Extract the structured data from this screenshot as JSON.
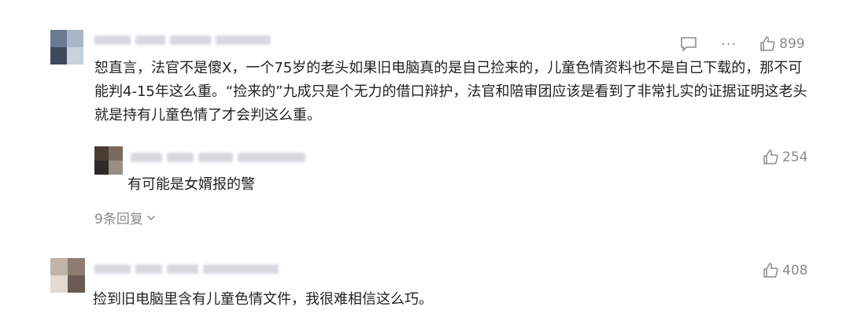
{
  "comments": [
    {
      "id": 1,
      "text": "恕直言，法官不是傻X，一个75岁的老头如果旧电脑真的是自己捡来的，儿童色情资料也不是自己下载的，那不可能判4-15年这么重。“捡来的”九成只是个无力的借口辩护，法官和陪审团应该是看到了非常扎实的证据证明这老头就是持有儿童色情了才会判这么重。",
      "likes": "899",
      "icons": [
        "comment-icon",
        "more-icon",
        "like-icon"
      ],
      "avatar_colors": [
        "#6b7a91",
        "#aab6c8",
        "#3e4a5c",
        "#c9d1dc"
      ]
    },
    {
      "id": 2,
      "text": "有可能是女婿报的警",
      "likes": "254",
      "icons": [
        "like-icon"
      ],
      "avatar_colors": [
        "#4a3b33",
        "#7a6a5e",
        "#2f2a27",
        "#9a8f86"
      ]
    },
    {
      "id": 3,
      "text": "捡到旧电脑里含有儿童色情文件，我很难相信这么巧。",
      "likes": "408",
      "icons": [
        "like-icon"
      ],
      "avatar_colors": [
        "#bfb3aa",
        "#8f7d72",
        "#e2dad3",
        "#6b5b52"
      ]
    }
  ],
  "replies_toggle": {
    "label": "9条回复",
    "icon": "chevron-down-icon"
  },
  "more_glyph": "···",
  "colors": {
    "text": "#222222",
    "meta": "#8a8a8a",
    "blur": "#d6d9de"
  }
}
